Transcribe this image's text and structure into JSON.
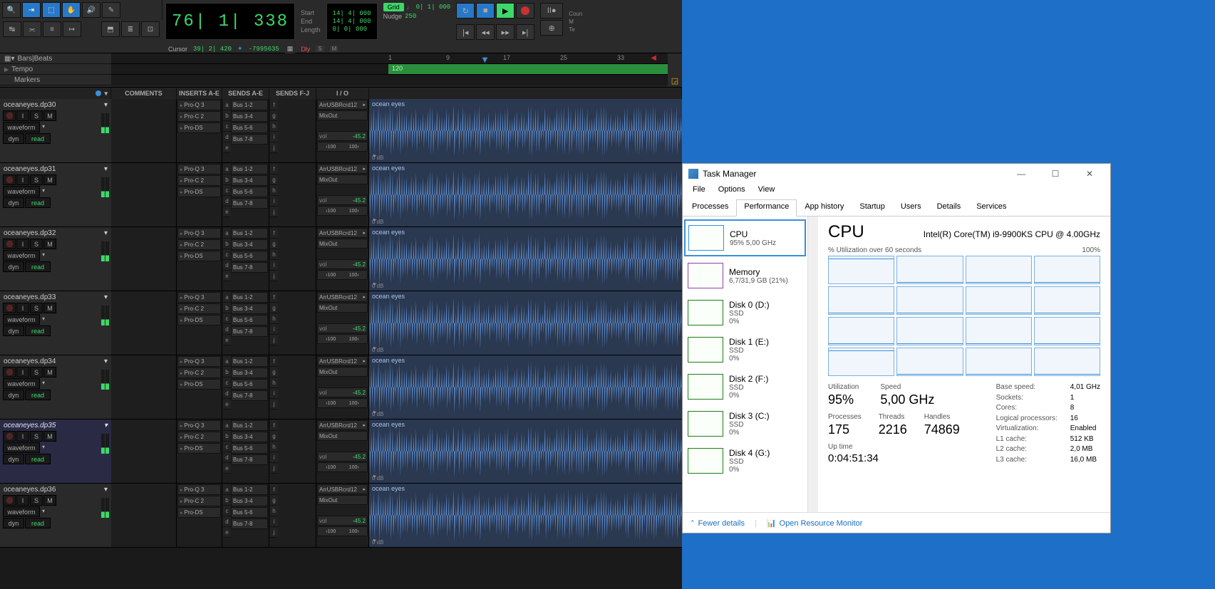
{
  "daw": {
    "counter_main": "76| 1| 338",
    "counter_labels": {
      "start": "Start",
      "end": "End",
      "length": "Length"
    },
    "counter_vals": {
      "start": "14| 4| 000",
      "end": "14| 4| 000",
      "length": "0| 0| 000"
    },
    "cursor_label": "Cursor",
    "cursor_val": "39| 2| 420",
    "cursor_val2": "-7995635",
    "dly_label": "Dly",
    "grid": {
      "label": "Grid",
      "val": "0| 1| 000",
      "nudge_label": "Nudge",
      "nudge_val": "250"
    },
    "count_label": "Coun",
    "m_label": "M",
    "te_label": "Te",
    "ruler": {
      "barsbeats": "Bars|Beats",
      "tempo": "Tempo",
      "markers": "Markers",
      "tempo_bpm": "120",
      "ticks": [
        "1",
        "9",
        "17",
        "25",
        "33"
      ]
    },
    "cols": {
      "comments": "COMMENTS",
      "inserts": "INSERTS A-E",
      "sends_ae": "SENDS A-E",
      "sends_fj": "SENDS F-J",
      "io": "I / O"
    },
    "inserts": [
      "Pro-Q 3",
      "Pro-C 2",
      "Pro-DS"
    ],
    "sends": [
      "Bus 1-2",
      "Bus 3-4",
      "Bus 5-6",
      "Bus 7-8"
    ],
    "send_letters_ae": [
      "a",
      "b",
      "c",
      "d",
      "e"
    ],
    "send_letters_fj": [
      "f",
      "g",
      "h",
      "i",
      "j"
    ],
    "io": {
      "out1": "ArrUSBRcrd12",
      "out2": "MixOut",
      "vol_l": "vol",
      "vol_v": "-45.2",
      "pan_l": "‹100",
      "pan_r": "100›"
    },
    "clip_name": "ocean eyes",
    "db_label": "0 dB",
    "track_common": {
      "waveform": "waveform",
      "dyn": "dyn",
      "read": "read",
      "i": "I",
      "s": "S",
      "m": "M"
    },
    "tracks": [
      {
        "name": "oceaneyes.dp30",
        "hilite": false
      },
      {
        "name": "oceaneyes.dp31",
        "hilite": false
      },
      {
        "name": "oceaneyes.dp32",
        "hilite": false
      },
      {
        "name": "oceaneyes.dp33",
        "hilite": false
      },
      {
        "name": "oceaneyes.dp34",
        "hilite": false
      },
      {
        "name": "oceaneyes.dp35",
        "hilite": true
      },
      {
        "name": "oceaneyes.dp36",
        "hilite": false
      }
    ]
  },
  "tm": {
    "title": "Task Manager",
    "menu": [
      "File",
      "Options",
      "View"
    ],
    "tabs": [
      "Processes",
      "Performance",
      "App history",
      "Startup",
      "Users",
      "Details",
      "Services"
    ],
    "active_tab": "Performance",
    "sidebar": [
      {
        "title": "CPU",
        "sub": "95%  5,00 GHz",
        "type": "cpu"
      },
      {
        "title": "Memory",
        "sub": "6,7/31,9 GB (21%)",
        "type": "mem"
      },
      {
        "title": "Disk 0 (D:)",
        "sub": "SSD",
        "sub2": "0%",
        "type": "disk"
      },
      {
        "title": "Disk 1 (E:)",
        "sub": "SSD",
        "sub2": "0%",
        "type": "disk"
      },
      {
        "title": "Disk 2 (F:)",
        "sub": "SSD",
        "sub2": "0%",
        "type": "disk"
      },
      {
        "title": "Disk 3 (C:)",
        "sub": "SSD",
        "sub2": "0%",
        "type": "disk"
      },
      {
        "title": "Disk 4 (G:)",
        "sub": "SSD",
        "sub2": "0%",
        "type": "disk"
      }
    ],
    "main": {
      "heading": "CPU",
      "model": "Intel(R) Core(TM) i9-9900KS CPU @ 4.00GHz",
      "graph_label": "% Utilization over 60 seconds",
      "graph_max": "100%",
      "core_loads": [
        "hi",
        "lo",
        "lo",
        "lo",
        "lo",
        "lo",
        "lo",
        "lo",
        "lo",
        "lo",
        "lo",
        "lo",
        "hi",
        "lo",
        "lo",
        "lo"
      ],
      "stats": {
        "util_l": "Utilization",
        "util": "95%",
        "speed_l": "Speed",
        "speed": "5,00 GHz",
        "proc_l": "Processes",
        "proc": "175",
        "thr_l": "Threads",
        "thr": "2216",
        "hnd_l": "Handles",
        "hnd": "74869",
        "up_l": "Up time",
        "up": "0:04:51:34"
      },
      "details": [
        [
          "Base speed:",
          "4,01 GHz"
        ],
        [
          "Sockets:",
          "1"
        ],
        [
          "Cores:",
          "8"
        ],
        [
          "Logical processors:",
          "16"
        ],
        [
          "Virtualization:",
          "Enabled"
        ],
        [
          "L1 cache:",
          "512 KB"
        ],
        [
          "L2 cache:",
          "2,0 MB"
        ],
        [
          "L3 cache:",
          "16,0 MB"
        ]
      ]
    },
    "footer": {
      "fewer": "Fewer details",
      "resmon": "Open Resource Monitor"
    }
  }
}
